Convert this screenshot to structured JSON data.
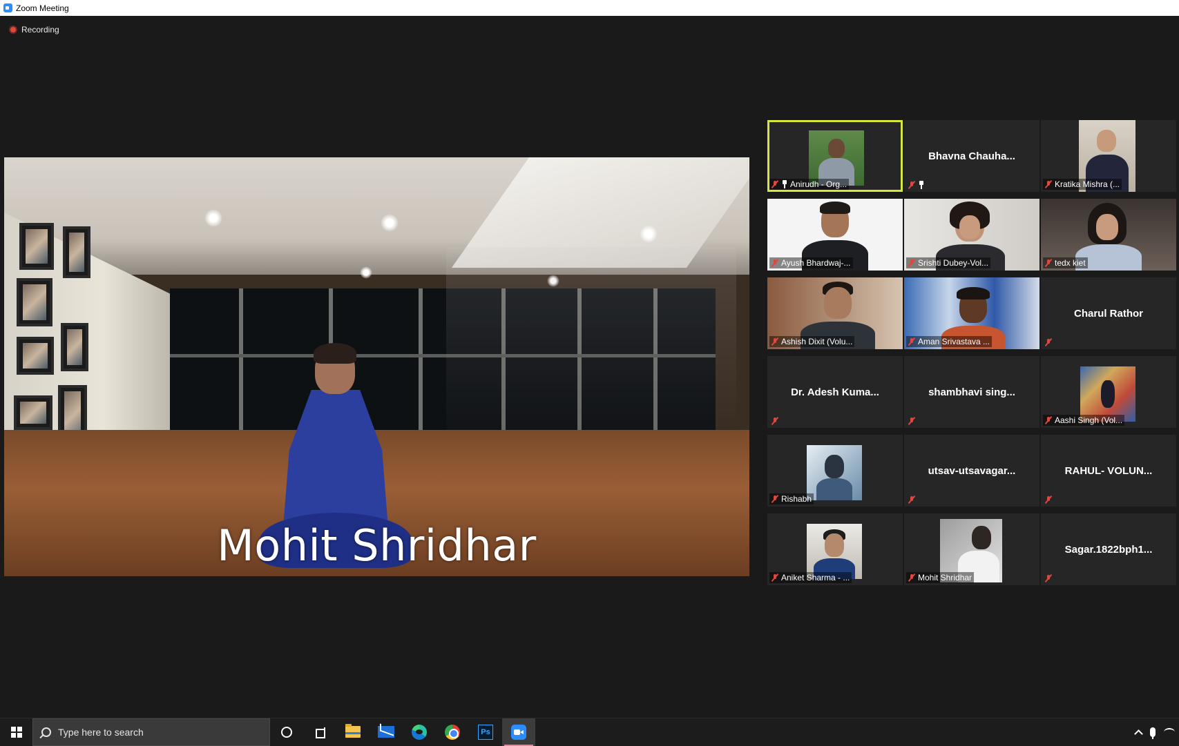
{
  "window": {
    "title": "Zoom Meeting"
  },
  "recording": {
    "label": "Recording"
  },
  "main_video": {
    "caption": "Mohit Shridhar"
  },
  "gallery": {
    "tiles": [
      {
        "name": "Anirudh - Org...",
        "muted": true,
        "pinned": true,
        "video": true,
        "active": true
      },
      {
        "name": "Bhavna  Chauha...",
        "muted": true,
        "pinned": true,
        "video": false
      },
      {
        "name": "Kratika Mishra (...",
        "muted": true,
        "video": true
      },
      {
        "name": "Ayush Bhardwaj-...",
        "muted": true,
        "video": true
      },
      {
        "name": "Srishti Dubey-Vol...",
        "muted": true,
        "video": true
      },
      {
        "name": "tedx kiet",
        "muted": true,
        "video": true
      },
      {
        "name": "Ashish Dixit (Volu...",
        "muted": true,
        "video": true
      },
      {
        "name": "Aman Srivastava ...",
        "muted": true,
        "video": true
      },
      {
        "name": "Charul Rathor",
        "muted": true,
        "video": false
      },
      {
        "name": "Dr. Adesh Kuma...",
        "muted": true,
        "video": false
      },
      {
        "name": "shambhavi  sing...",
        "muted": true,
        "video": false
      },
      {
        "name": "Aashi Singh (Vol...",
        "muted": true,
        "video": true
      },
      {
        "name": "Rishabh",
        "muted": true,
        "video": true
      },
      {
        "name": "utsav-utsavagar...",
        "muted": true,
        "video": false
      },
      {
        "name": "RAHUL- VOLUN...",
        "muted": true,
        "video": false
      },
      {
        "name": "Aniket Sharma - ...",
        "muted": true,
        "video": true
      },
      {
        "name": "Mohit Shridhar",
        "muted": true,
        "video": true
      },
      {
        "name": "Sagar.1822bph1...",
        "muted": true,
        "video": false
      }
    ]
  },
  "taskbar": {
    "search_placeholder": "Type here to search",
    "apps": [
      "cortana-icon",
      "task-view-icon",
      "file-explorer-icon",
      "mail-icon",
      "edge-icon",
      "chrome-icon",
      "photoshop-icon",
      "zoom-icon"
    ],
    "photoshop_label": "Ps"
  },
  "colors": {
    "background": "#1a1a1a",
    "tile": "#262626",
    "active_speaker": "#d6e73a",
    "mute": "#e2473d",
    "zoom_blue": "#2d8cff"
  }
}
